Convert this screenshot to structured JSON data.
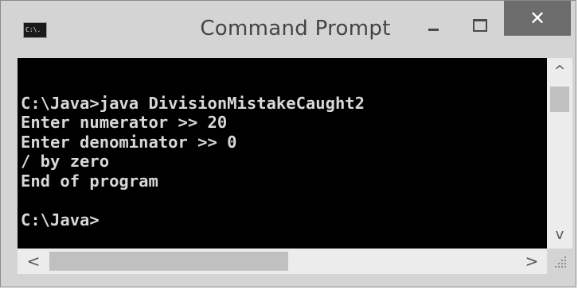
{
  "window": {
    "title": "Command Prompt",
    "icon_label": "C:\\.",
    "close_glyph": "✕"
  },
  "console": {
    "lines": [
      "",
      "C:\\Java>java DivisionMistakeCaught2",
      "Enter numerator >> 20",
      "Enter denominator >> 0",
      "/ by zero",
      "End of program",
      "",
      "C:\\Java>"
    ]
  },
  "scrollbars": {
    "up_glyph": "^",
    "down_glyph": "v",
    "left_glyph": "<",
    "right_glyph": ">"
  },
  "icons": {
    "app": "command-prompt-icon",
    "minimize": "minimize-icon",
    "maximize": "maximize-icon",
    "close": "close-icon",
    "grip": "resize-grip-icon"
  }
}
